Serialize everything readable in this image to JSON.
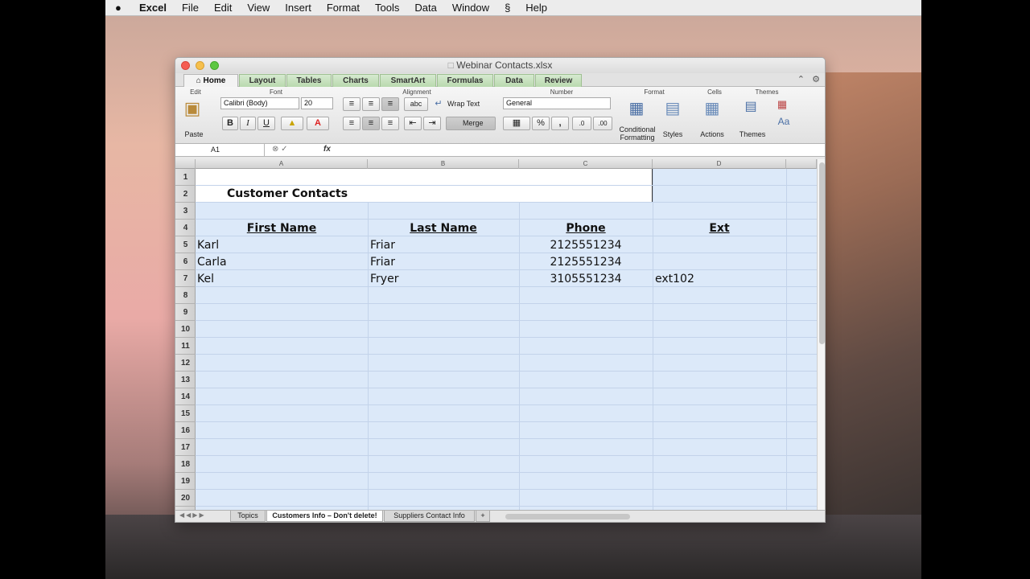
{
  "menubar": {
    "apple_icon": "",
    "items": [
      "Excel",
      "File",
      "Edit",
      "View",
      "Insert",
      "Format",
      "Tools",
      "Data",
      "Window",
      "Help"
    ],
    "script_icon": "script-icon"
  },
  "window": {
    "title": "Webinar Contacts.xlsx"
  },
  "ribbon_tabs": [
    "Home",
    "Layout",
    "Tables",
    "Charts",
    "SmartArt",
    "Formulas",
    "Data",
    "Review"
  ],
  "ribbon": {
    "groups": {
      "edit": "Edit",
      "font": "Font",
      "alignment": "Alignment",
      "number": "Number",
      "format": "Format",
      "cells": "Cells",
      "themes": "Themes"
    },
    "paste_label": "Paste",
    "font_name": "Calibri (Body)",
    "font_size": "20",
    "bold": "B",
    "italic": "I",
    "underline": "U",
    "wrap_text": "Wrap Text",
    "merge": "Merge",
    "number_format": "General",
    "percent": "%",
    "comma": ",",
    "conditional_formatting": "Conditional Formatting",
    "styles": "Styles",
    "actions": "Actions",
    "themes": "Themes",
    "themes_fonts": "Aa"
  },
  "formula_bar": {
    "name_box": "A1",
    "fx": "fx",
    "value": ""
  },
  "columns": [
    "A",
    "B",
    "C",
    "D"
  ],
  "rows": [
    "1",
    "2",
    "3",
    "4",
    "5",
    "6",
    "7",
    "8",
    "9",
    "10",
    "11",
    "12",
    "13",
    "14",
    "15",
    "16",
    "17",
    "18",
    "19",
    "20"
  ],
  "sheet": {
    "title": "Customer Contacts",
    "headers": [
      "First Name",
      "Last Name",
      "Phone",
      "Ext"
    ],
    "data": [
      [
        "Karl",
        "Friar",
        "2125551234",
        ""
      ],
      [
        "Carla",
        "Friar",
        "2125551234",
        ""
      ],
      [
        "Kel",
        "Fryer",
        "3105551234",
        "ext102"
      ]
    ]
  },
  "sheet_tabs": [
    "Topics",
    "Customers Info – Don't delete!",
    "Suppliers Contact Info",
    "+"
  ],
  "colors": {
    "ribbon_tab_green": "#b9d9ae",
    "cell_fill": "#dce9f9"
  }
}
